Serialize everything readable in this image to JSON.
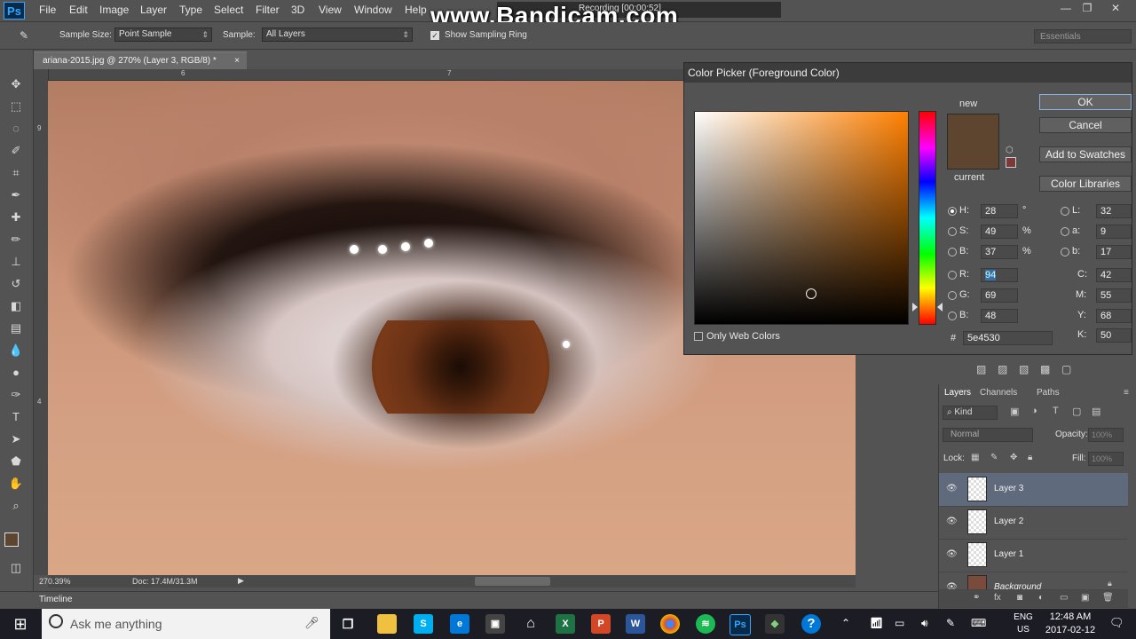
{
  "menu": {
    "items": [
      "File",
      "Edit",
      "Image",
      "Layer",
      "Type",
      "Select",
      "Filter",
      "3D",
      "View",
      "Window",
      "Help"
    ],
    "app_logo": "Ps"
  },
  "watermark": "www.Bandicam.com",
  "recording": "Recording [00:00:52]",
  "options": {
    "sample_size_label": "Sample Size:",
    "sample_size_value": "Point Sample",
    "sample_label": "Sample:",
    "sample_value": "All Layers",
    "show_ring_label": "Show Sampling Ring",
    "workspace": "Essentials"
  },
  "document": {
    "tab_title": "ariana-2015.jpg @ 270% (Layer 3, RGB/8) *",
    "ruler_top_marks": [
      "6",
      "7"
    ],
    "ruler_left_marks": [
      "9",
      "4"
    ],
    "zoom": "270.39%",
    "doc_size": "Doc: 17.4M/31.3M"
  },
  "timeline_label": "Timeline",
  "color_picker": {
    "title": "Color Picker (Foreground Color)",
    "new_label": "new",
    "current_label": "current",
    "new_color": "#5e4530",
    "current_color": "#5e4530",
    "buttons": {
      "ok": "OK",
      "cancel": "Cancel",
      "swatches": "Add to Swatches",
      "libraries": "Color Libraries"
    },
    "hsb": {
      "h": "28",
      "s": "49",
      "b": "37",
      "h_unit": "°",
      "s_unit": "%",
      "b_unit": "%"
    },
    "rgb": {
      "r": "94",
      "g": "69",
      "b": "48"
    },
    "lab": {
      "l": "32",
      "a": "9",
      "b": "17"
    },
    "cmyk": {
      "c": "42",
      "m": "55",
      "y": "68",
      "k": "50"
    },
    "hex": "5e4530",
    "hex_label": "#",
    "only_web_label": "Only Web Colors",
    "labels": {
      "h": "H:",
      "s": "S:",
      "b": "B:",
      "r": "R:",
      "g": "G:",
      "bb": "B:",
      "l": "L:",
      "a": "a:",
      "lb": "b:",
      "c": "C:",
      "m": "M:",
      "y": "Y:",
      "k": "K:"
    }
  },
  "layers": {
    "tabs": [
      "Layers",
      "Channels",
      "Paths"
    ],
    "kind_label": "Kind",
    "blend_mode": "Normal",
    "opacity_label": "Opacity:",
    "opacity_value": "100%",
    "lock_label": "Lock:",
    "fill_label": "Fill:",
    "fill_value": "100%",
    "items": [
      {
        "name": "Layer 3",
        "selected": true
      },
      {
        "name": "Layer 2",
        "selected": false
      },
      {
        "name": "Layer 1",
        "selected": false
      },
      {
        "name": "Background",
        "selected": false
      }
    ]
  },
  "taskbar": {
    "search_placeholder": "Ask me anything",
    "lang_1": "ENG",
    "lang_2": "US",
    "time": "12:48 AM",
    "date": "2017-02-12"
  }
}
